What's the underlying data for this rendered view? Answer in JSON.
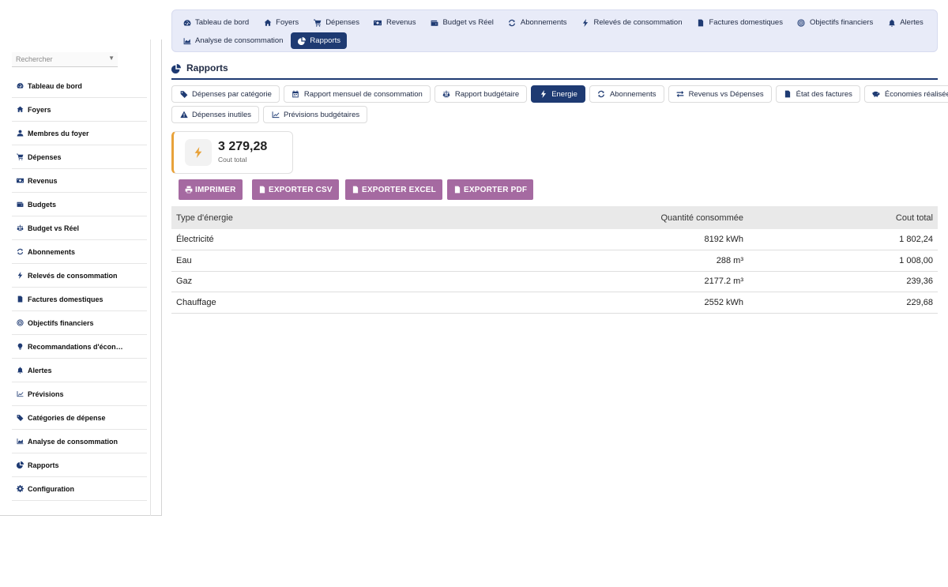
{
  "top_nav": {
    "row1": [
      {
        "label": "Tableau de bord",
        "icon": "dashboard-icon"
      },
      {
        "label": "Foyers",
        "icon": "home-icon"
      },
      {
        "label": "Dépenses",
        "icon": "cart-icon"
      },
      {
        "label": "Revenus",
        "icon": "money-icon"
      },
      {
        "label": "Budget vs Réel",
        "icon": "wallet-icon"
      },
      {
        "label": "Abonnements",
        "icon": "sync-icon"
      },
      {
        "label": "Relevés de consommation",
        "icon": "bolt-icon"
      },
      {
        "label": "Factures domestiques",
        "icon": "file-icon"
      },
      {
        "label": "Objectifs financiers",
        "icon": "target-icon"
      },
      {
        "label": "Alertes",
        "icon": "bell-icon"
      }
    ],
    "row2": [
      {
        "label": "Analyse de consommation",
        "icon": "chart-area-icon"
      },
      {
        "label": "Rapports",
        "icon": "pie-chart-icon",
        "active": true
      }
    ]
  },
  "sidebar": {
    "search_placeholder": "Rechercher",
    "items": [
      {
        "label": "Tableau de bord",
        "icon": "dashboard-icon"
      },
      {
        "label": "Foyers",
        "icon": "home-icon"
      },
      {
        "label": "Membres du foyer",
        "icon": "user-icon"
      },
      {
        "label": "Dépenses",
        "icon": "cart-icon"
      },
      {
        "label": "Revenus",
        "icon": "money-icon"
      },
      {
        "label": "Budgets",
        "icon": "wallet-icon"
      },
      {
        "label": "Budget vs Réel",
        "icon": "balance-scale-icon"
      },
      {
        "label": "Abonnements",
        "icon": "sync-icon"
      },
      {
        "label": "Relevés de consommation",
        "icon": "bolt-icon"
      },
      {
        "label": "Factures domestiques",
        "icon": "file-icon"
      },
      {
        "label": "Objectifs financiers",
        "icon": "target-icon"
      },
      {
        "label": "Recommandations d'écon…",
        "icon": "lightbulb-icon"
      },
      {
        "label": "Alertes",
        "icon": "bell-icon"
      },
      {
        "label": "Prévisions",
        "icon": "line-chart-icon"
      },
      {
        "label": "Catégories de dépense",
        "icon": "tags-icon"
      },
      {
        "label": "Analyse de consommation",
        "icon": "chart-area-icon"
      },
      {
        "label": "Rapports",
        "icon": "pie-chart-icon"
      },
      {
        "label": "Configuration",
        "icon": "gear-icon"
      }
    ]
  },
  "page": {
    "title": "Rapports",
    "icon": "pie-chart-icon"
  },
  "report_tabs": {
    "row1": [
      {
        "label": "Dépenses par catégorie",
        "icon": "tags-icon"
      },
      {
        "label": "Rapport mensuel de consommation",
        "icon": "calendar-icon"
      },
      {
        "label": "Rapport budgétaire",
        "icon": "balance-scale-icon"
      },
      {
        "label": "Energie",
        "icon": "bolt-icon",
        "active": true
      },
      {
        "label": "Abonnements",
        "icon": "sync-icon"
      },
      {
        "label": "Revenus vs Dépenses",
        "icon": "exchange-icon"
      },
      {
        "label": "État des factures",
        "icon": "file-icon"
      },
      {
        "label": "Économies réalisées",
        "icon": "piggy-bank-icon"
      }
    ],
    "row2": [
      {
        "label": "Dépenses inutiles",
        "icon": "warning-icon"
      },
      {
        "label": "Prévisions budgétaires",
        "icon": "line-chart-icon"
      }
    ]
  },
  "kpi": {
    "value": "3 279,28",
    "label": "Cout total",
    "icon": "bolt-icon",
    "accent": "#e8a23a"
  },
  "export_buttons": {
    "print": "IMPRIMER",
    "csv": "EXPORTER CSV",
    "excel": "EXPORTER EXCEL",
    "pdf": "EXPORTER PDF"
  },
  "energy_table": {
    "headers": [
      "Type d'énergie",
      "Quantité consommée",
      "Cout total"
    ],
    "rows": [
      [
        "Électricité",
        "8192 kWh",
        "1 802,24"
      ],
      [
        "Eau",
        "288 m³",
        "1 008,00"
      ],
      [
        "Gaz",
        "2177.2 m³",
        "239,36"
      ],
      [
        "Chauffage",
        "2552 kWh",
        "229,68"
      ]
    ]
  },
  "colors": {
    "primary": "#1e3a72",
    "nav_background": "#e8ebf8",
    "export_button": "#a56aa1",
    "kpi_accent": "#e8a23a"
  }
}
